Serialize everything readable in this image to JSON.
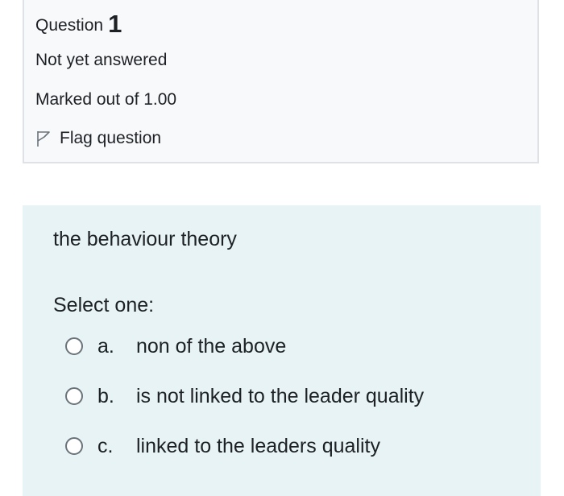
{
  "info": {
    "question_label": "Question",
    "question_number": "1",
    "state": "Not yet answered",
    "grade": "Marked out of 1.00",
    "flag_label": "Flag question"
  },
  "question": {
    "text": "the behaviour theory",
    "prompt": "Select one:",
    "options": [
      {
        "letter": "a.",
        "label": "non of the above",
        "selected": false
      },
      {
        "letter": "b.",
        "label": "is not linked to the leader quality",
        "selected": false
      },
      {
        "letter": "c.",
        "label": "linked to the leaders quality",
        "selected": false
      }
    ]
  },
  "icons": {
    "flag": "flag-icon",
    "radio": "radio-button"
  },
  "colors": {
    "info_background": "#f8f9fa",
    "info_border": "#dee2e6",
    "question_background": "#e7f3f5",
    "text": "#1d2125"
  }
}
